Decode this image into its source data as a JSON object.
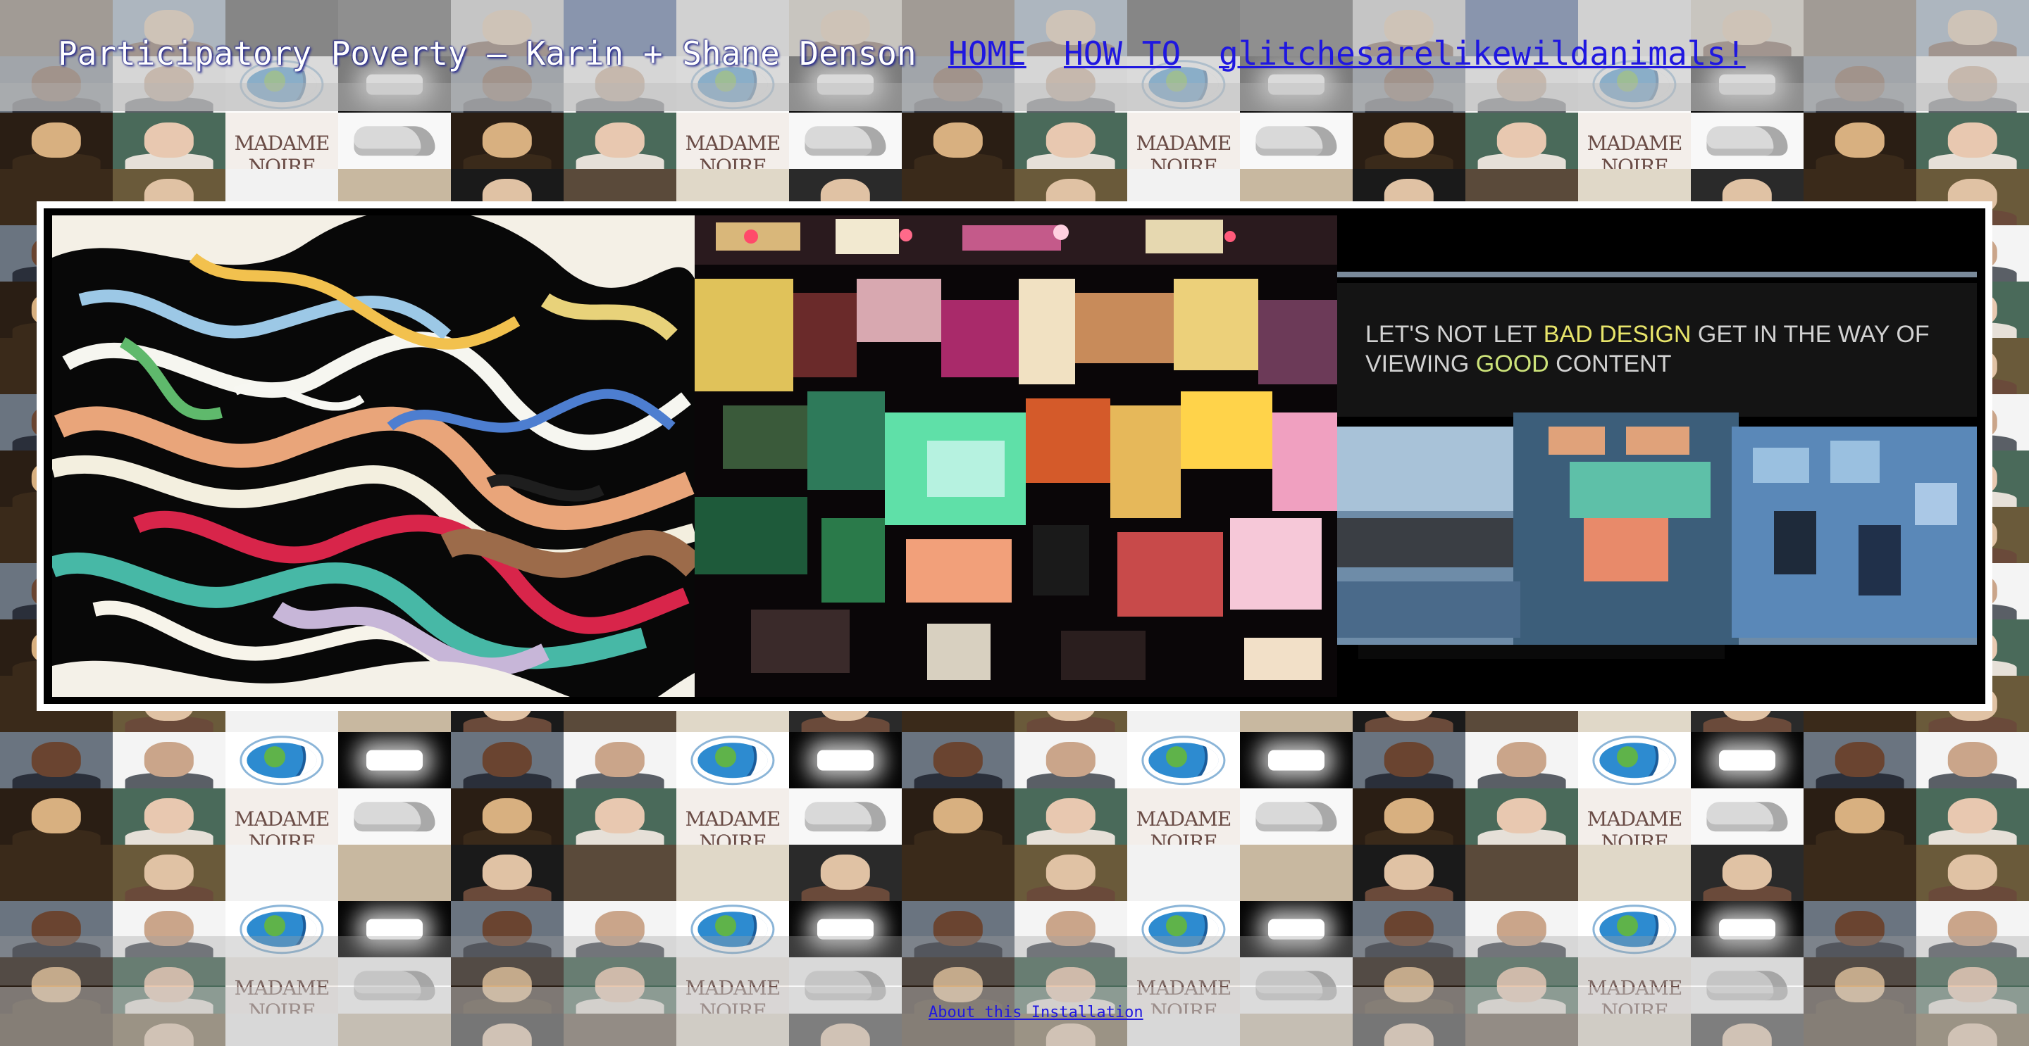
{
  "header": {
    "title": "Participatory Poverty – Karin + Shane Denson",
    "nav": [
      {
        "label": "HOME"
      },
      {
        "label": "HOW TO"
      },
      {
        "label": "glitchesarelikewildanimals!"
      }
    ]
  },
  "frame": {
    "overlay_text": {
      "line1_a": "LET'S NOT LET ",
      "line1_b": "BAD DESIGN",
      "line1_c": " GET IN THE WAY OF",
      "line2_a": "VIEWING ",
      "line2_b": "GOOD",
      "line2_c": " CONTENT"
    }
  },
  "wall_thumbnails": {
    "wordmark": "MADAME NOIRE"
  },
  "footer": {
    "about_link": "About this Installation"
  },
  "colors": {
    "link": "#1f17e0",
    "title_shadow": "#23268a",
    "frame_border": "#ffffff",
    "header_band": "#c3c3c3"
  }
}
